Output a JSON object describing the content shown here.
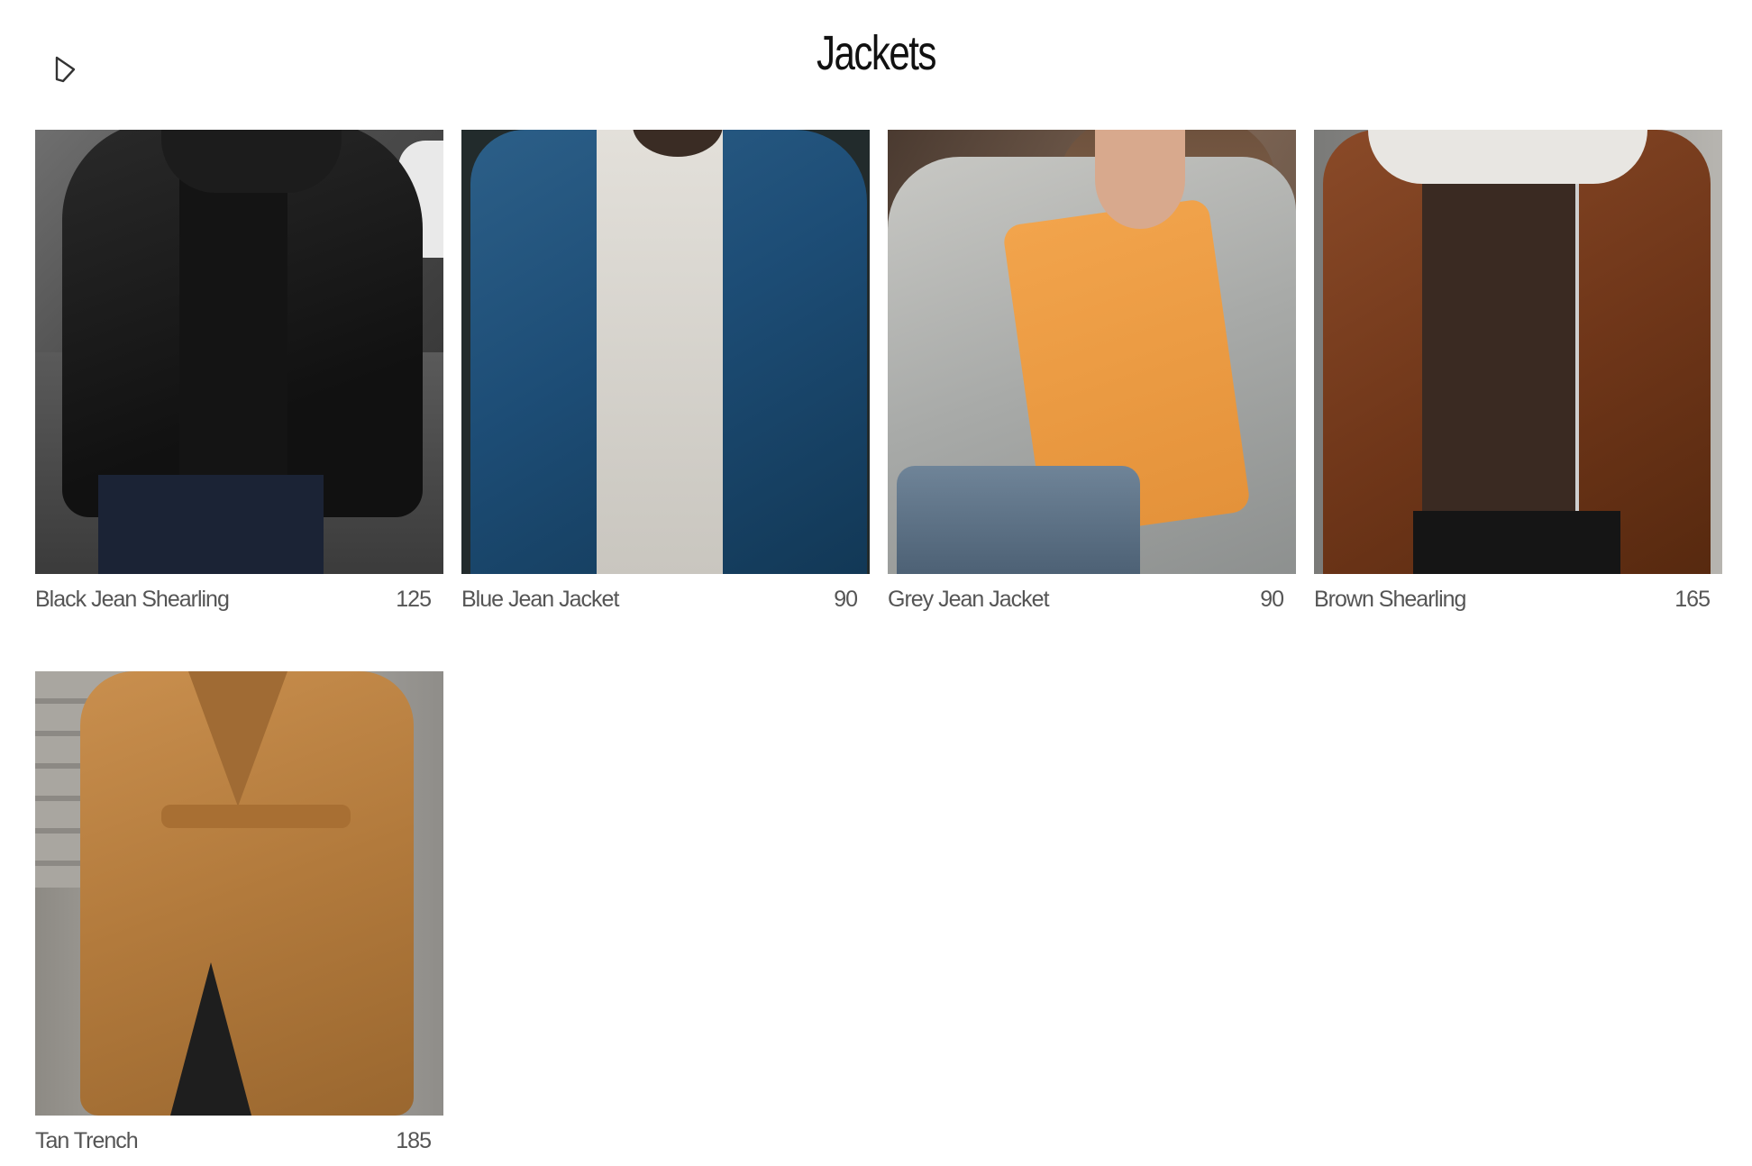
{
  "page": {
    "title": "Jackets"
  },
  "header": {
    "back_icon": "back-arrow-icon"
  },
  "products": [
    {
      "name": "Black Jean Shearling",
      "price": "125"
    },
    {
      "name": "Blue Jean Jacket",
      "price": "90"
    },
    {
      "name": "Grey Jean Jacket",
      "price": "90"
    },
    {
      "name": "Brown Shearling",
      "price": "165"
    },
    {
      "name": "Tan Trench",
      "price": "185"
    }
  ]
}
